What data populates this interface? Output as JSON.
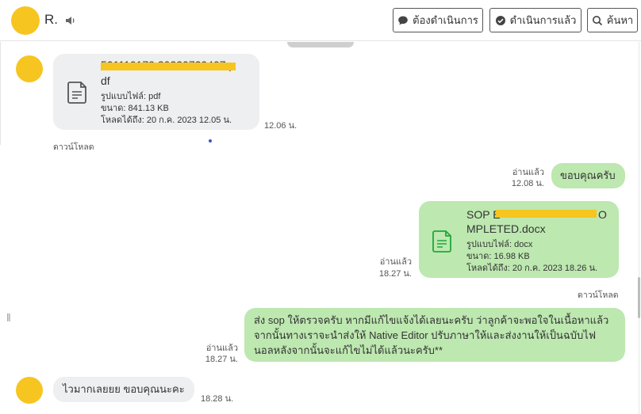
{
  "header": {
    "contact_name": "R.",
    "buttons": {
      "todo": "ต้องดำเนินการ",
      "done": "ดำเนินการแล้ว",
      "search": "ค้นหา"
    }
  },
  "messages": {
    "m1": {
      "file_name_line1": "501110179 20220720407.p",
      "file_name_line2": "df",
      "type_label": "รูปแบบไฟล์: pdf",
      "size_label": "ขนาด: 841.13 KB",
      "expiry_label": "โหลดได้ถึง: 20 ก.ค. 2023 12.05 น.",
      "time": "12.06 น.",
      "download": "ดาวน์โหลด"
    },
    "m2": {
      "text": "ขอบคุณครับ",
      "read": "อ่านแล้ว",
      "time": "12.08 น."
    },
    "m3": {
      "file_name_line1": "SOP E",
      "file_name_tail": "O",
      "file_name_line2": "MPLETED.docx",
      "type_label": "รูปแบบไฟล์: docx",
      "size_label": "ขนาด: 16.98 KB",
      "expiry_label": "โหลดได้ถึง: 20 ก.ค. 2023 18.26 น.",
      "read": "อ่านแล้ว",
      "time": "18.27 น.",
      "download": "ดาวน์โหลด"
    },
    "m4": {
      "line1": "ส่ง sop ให้ตรวจครับ หากมีแก้ไขแจ้งได้เลยนะครับ ว่าลูกค้าจะพอใจในเนื้อหาแล้ว",
      "line2": "จากนั้นทางเราจะนำส่งให้ Native Editor ปรับภาษาให้และส่งงานให้เป็นฉบับไฟ",
      "line3": "นอลหลังจากนั้นจะแก้ไขไม่ได้แล้วนะครับ**",
      "read": "อ่านแล้ว",
      "time": "18.27 น."
    },
    "m5": {
      "text": "ไวมากเลยยย ขอบคุณนะคะ",
      "time": "18.28 น."
    }
  },
  "colors": {
    "avatar": "#f7c51f",
    "outgoing_bubble": "#bde8b0",
    "incoming_bubble": "#eeeff1",
    "docx_icon": "#1fa83b",
    "pdf_icon": "#555555"
  },
  "icons": [
    "speaker-icon",
    "chat-bubble-icon",
    "check-circle-icon",
    "search-icon",
    "file-icon"
  ]
}
